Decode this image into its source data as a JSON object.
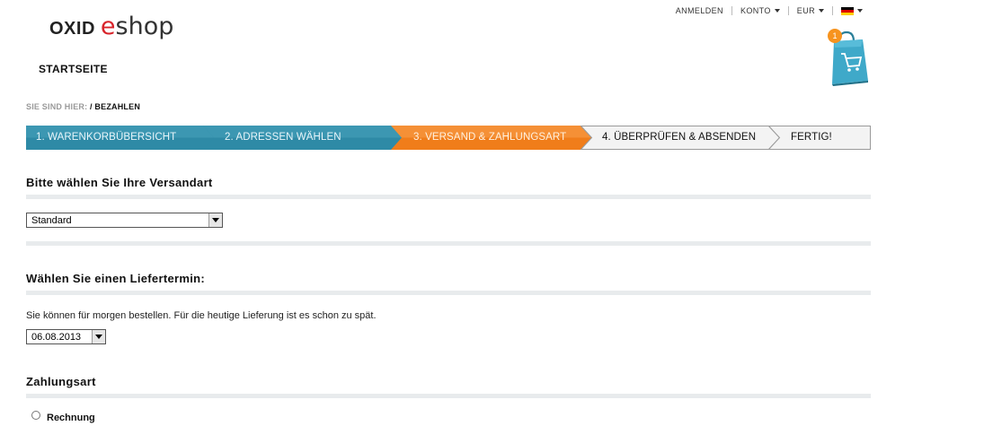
{
  "logo": {
    "part1": "OXID",
    "part2": "e",
    "part3": "shop"
  },
  "topnav": {
    "login": "ANMELDEN",
    "account": "KONTO",
    "currency": "EUR",
    "language_icon": "german-flag-icon"
  },
  "home_link": "STARTSEITE",
  "cart": {
    "count": "1",
    "icon": "shopping-bag-icon"
  },
  "breadcrumb": {
    "label": "SIE SIND HIER:",
    "current": "/ BEZAHLEN"
  },
  "steps": [
    {
      "label": "1. WARENKORBÜBERSICHT",
      "state": "done"
    },
    {
      "label": "2. ADRESSEN WÄHLEN",
      "state": "done"
    },
    {
      "label": "3. VERSAND & ZAHLUNGSART",
      "state": "active"
    },
    {
      "label": "4. ÜBERPRÜFEN & ABSENDEN",
      "state": "todo"
    },
    {
      "label": "FERTIG!",
      "state": "todo"
    }
  ],
  "colors": {
    "done": "#2e8aa6",
    "active": "#f07d1a",
    "todo": "#f3f3f3"
  },
  "shipping": {
    "title": "Bitte wählen Sie Ihre Versandart",
    "selected": "Standard"
  },
  "delivery": {
    "title": "Wählen Sie einen Liefertermin:",
    "note": "Sie können für morgen bestellen. Für die heutige Lieferung ist es schon zu spät.",
    "date": "06.08.2013"
  },
  "payment": {
    "title": "Zahlungsart",
    "option": "Rechnung"
  }
}
